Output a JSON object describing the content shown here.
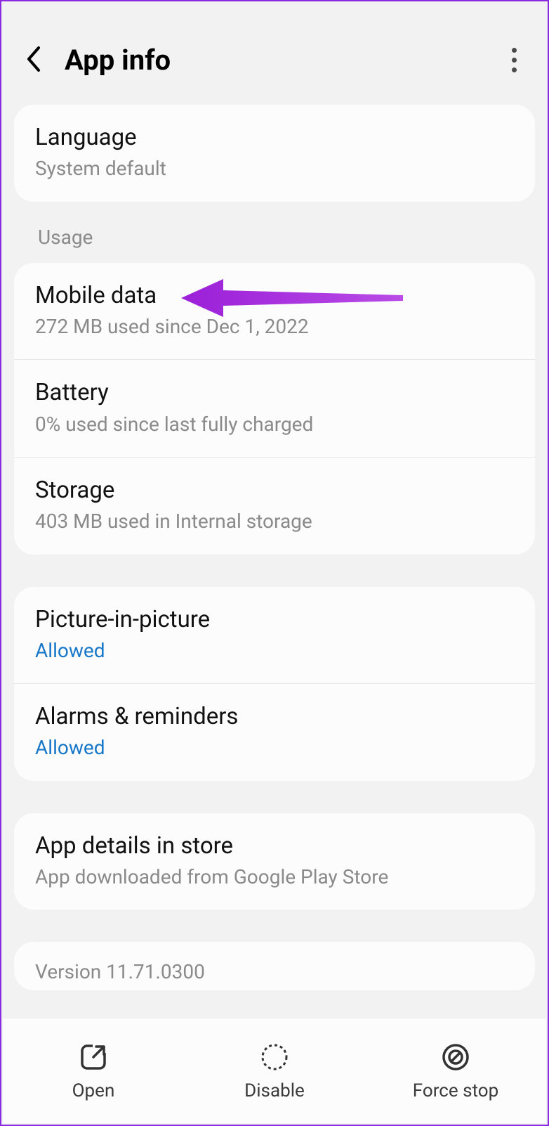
{
  "header": {
    "title": "App info"
  },
  "card1": {
    "language": {
      "title": "Language",
      "sub": "System default"
    }
  },
  "section_usage_label": "Usage",
  "usage": {
    "mobile": {
      "title": "Mobile data",
      "sub": "272 MB used since Dec 1, 2022"
    },
    "battery": {
      "title": "Battery",
      "sub": "0% used since last fully charged"
    },
    "storage": {
      "title": "Storage",
      "sub": "403 MB used in Internal storage"
    }
  },
  "permissions": {
    "pip": {
      "title": "Picture-in-picture",
      "sub": "Allowed"
    },
    "alarms": {
      "title": "Alarms & reminders",
      "sub": "Allowed"
    }
  },
  "store": {
    "title": "App details in store",
    "sub": "App downloaded from Google Play Store"
  },
  "version": {
    "label": "Version 11.71.0300"
  },
  "bottom": {
    "open": "Open",
    "disable": "Disable",
    "forcestop": "Force stop"
  }
}
